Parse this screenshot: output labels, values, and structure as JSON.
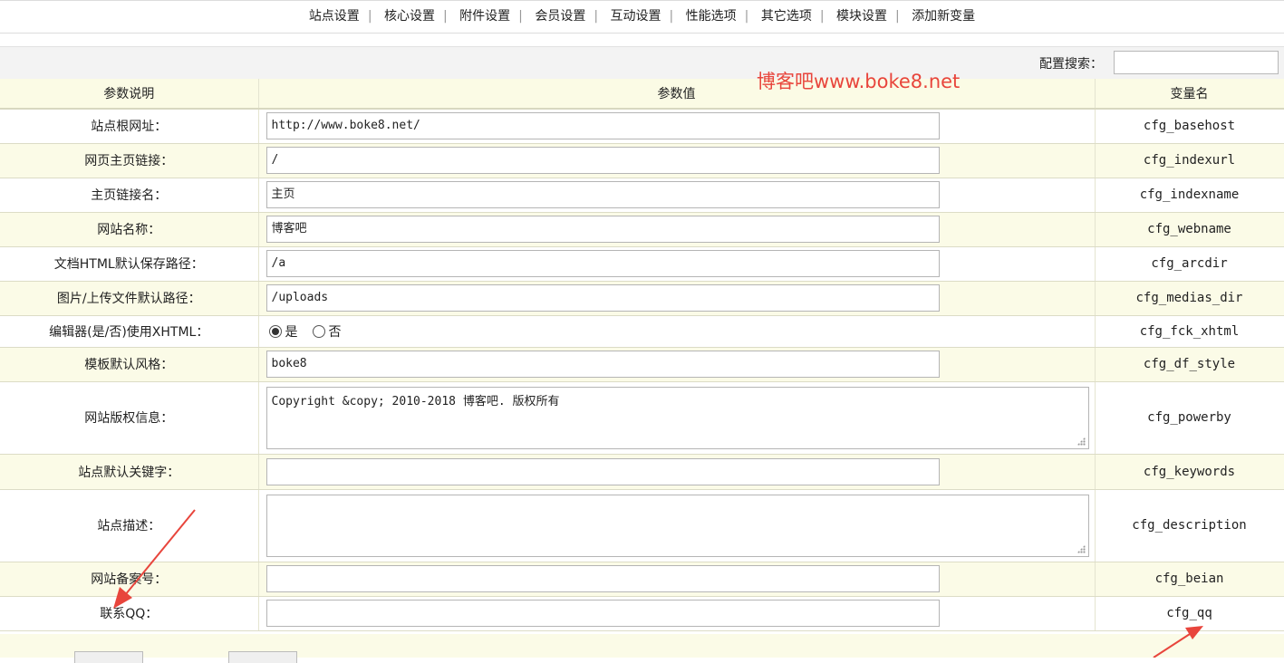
{
  "nav": {
    "items": [
      "站点设置",
      "核心设置",
      "附件设置",
      "会员设置",
      "互动设置",
      "性能选项",
      "其它选项",
      "模块设置",
      "添加新变量"
    ],
    "separator": "|"
  },
  "search": {
    "label": "配置搜索：",
    "value": ""
  },
  "watermark": "博客吧www.boke8.net",
  "table": {
    "headers": {
      "name": "参数说明",
      "value": "参数值",
      "var": "变量名"
    },
    "rows": [
      {
        "label": "站点根网址：",
        "type": "text",
        "value": "http://www.boke8.net/",
        "var": "cfg_basehost"
      },
      {
        "label": "网页主页链接：",
        "type": "text",
        "value": "/",
        "var": "cfg_indexurl"
      },
      {
        "label": "主页链接名：",
        "type": "text",
        "value": "主页",
        "var": "cfg_indexname"
      },
      {
        "label": "网站名称：",
        "type": "text",
        "value": "博客吧",
        "var": "cfg_webname"
      },
      {
        "label": "文档HTML默认保存路径：",
        "type": "text",
        "value": "/a",
        "var": "cfg_arcdir"
      },
      {
        "label": "图片/上传文件默认路径：",
        "type": "text",
        "value": "/uploads",
        "var": "cfg_medias_dir"
      },
      {
        "label": "编辑器(是/否)使用XHTML：",
        "type": "radio",
        "options": [
          "是",
          "否"
        ],
        "selected": "是",
        "var": "cfg_fck_xhtml"
      },
      {
        "label": "模板默认风格：",
        "type": "text",
        "value": "boke8",
        "var": "cfg_df_style"
      },
      {
        "label": "网站版权信息：",
        "type": "textarea",
        "value": "Copyright &copy; 2010-2018 博客吧. 版权所有",
        "var": "cfg_powerby"
      },
      {
        "label": "站点默认关键字：",
        "type": "text",
        "value": "",
        "var": "cfg_keywords"
      },
      {
        "label": "站点描述：",
        "type": "textarea",
        "value": "",
        "var": "cfg_description"
      },
      {
        "label": "网站备案号：",
        "type": "text",
        "value": "",
        "var": "cfg_beian"
      },
      {
        "label": "联系QQ：",
        "type": "text",
        "value": "",
        "var": "cfg_qq"
      }
    ]
  },
  "colors": {
    "watermark": "#e8453c",
    "row_alt": "#fbfbe7",
    "arrow": "#e8453c"
  }
}
